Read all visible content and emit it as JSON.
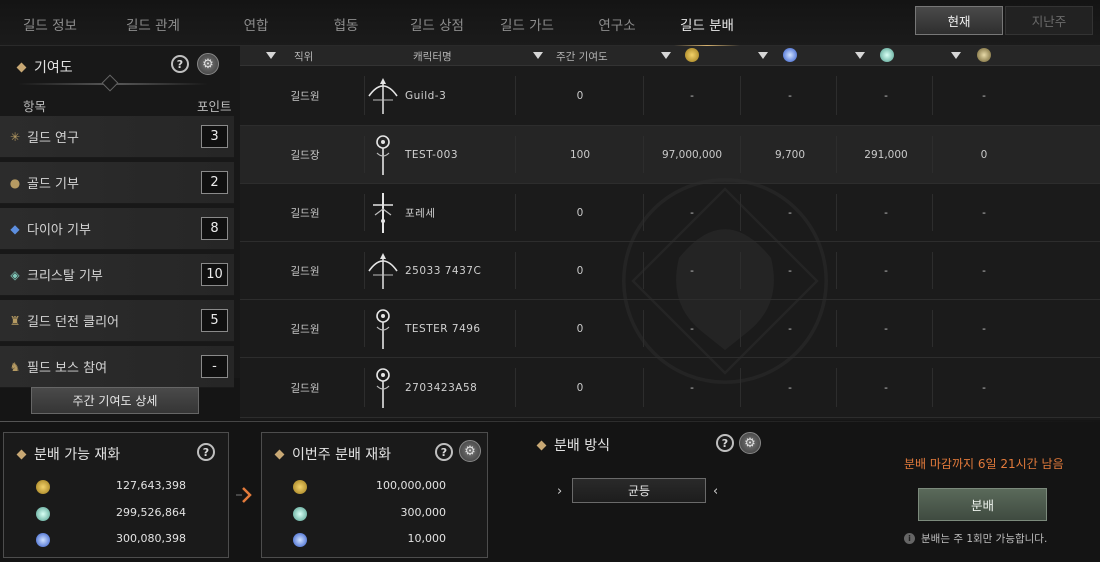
{
  "nav": {
    "tabs": [
      "길드 정보",
      "길드 관계",
      "연합",
      "협동",
      "길드 상점",
      "길드 가드",
      "연구소",
      "길드 분배"
    ],
    "active": "길드 분배",
    "current_label": "현재",
    "last_week_label": "지난주"
  },
  "contribution": {
    "title": "기여도",
    "col_item": "항목",
    "col_points": "포인트",
    "items": [
      {
        "label": "길드 연구",
        "points": "3",
        "icon": "research-icon"
      },
      {
        "label": "골드 기부",
        "points": "2",
        "icon": "gold-coin-icon"
      },
      {
        "label": "다이아 기부",
        "points": "8",
        "icon": "diamond-icon"
      },
      {
        "label": "크리스탈 기부",
        "points": "10",
        "icon": "crystal-icon"
      },
      {
        "label": "길드 던전 클리어",
        "points": "5",
        "icon": "dungeon-icon"
      },
      {
        "label": "필드 보스 참여",
        "points": "-",
        "icon": "boss-icon"
      }
    ],
    "weekly_detail_button": "주간 기여도 상세"
  },
  "table": {
    "headers": {
      "rank": "직위",
      "name": "캐릭터명",
      "weekly": "주간 기여도"
    },
    "currency_icons": [
      "gold-coin-icon",
      "diamond-icon",
      "crystal-icon",
      "guild-coin-icon"
    ],
    "rows": [
      {
        "rank": "길드원",
        "class": "bow",
        "name": "Guild-3",
        "weekly": "0",
        "gold": "-",
        "diamond": "-",
        "crystal": "-",
        "extra": "-"
      },
      {
        "rank": "길드장",
        "class": "staff",
        "name": "TEST-003",
        "weekly": "100",
        "gold": "97,000,000",
        "diamond": "9,700",
        "crystal": "291,000",
        "extra": "0"
      },
      {
        "rank": "길드원",
        "class": "sword",
        "name": "포레세",
        "weekly": "0",
        "gold": "-",
        "diamond": "-",
        "crystal": "-",
        "extra": "-"
      },
      {
        "rank": "길드원",
        "class": "bow",
        "name": "25033 7437C",
        "weekly": "0",
        "gold": "-",
        "diamond": "-",
        "crystal": "-",
        "extra": "-"
      },
      {
        "rank": "길드원",
        "class": "staff",
        "name": "TESTER 7496",
        "weekly": "0",
        "gold": "-",
        "diamond": "-",
        "crystal": "-",
        "extra": "-"
      },
      {
        "rank": "길드원",
        "class": "staff",
        "name": "2703423A58",
        "weekly": "0",
        "gold": "-",
        "diamond": "-",
        "crystal": "-",
        "extra": "-"
      }
    ]
  },
  "available": {
    "title": "분배 가능 재화",
    "items": [
      {
        "icon": "gold-coin-icon",
        "amount": "127,643,398"
      },
      {
        "icon": "crystal-icon",
        "amount": "299,526,864"
      },
      {
        "icon": "diamond-icon",
        "amount": "300,080,398"
      }
    ]
  },
  "this_week": {
    "title": "이번주 분배 재화",
    "items": [
      {
        "icon": "gold-coin-icon",
        "amount": "100,000,000"
      },
      {
        "icon": "crystal-icon",
        "amount": "300,000"
      },
      {
        "icon": "diamond-icon",
        "amount": "10,000"
      }
    ]
  },
  "method": {
    "title": "분배 방식",
    "value": "균등"
  },
  "deadline_text": "분배 마감까지 6일 21시간 남음",
  "distribute_button": "분배",
  "note": "분배는 주 1회만 가능합니다.",
  "colors": {
    "accent": "#c8a874",
    "deadline": "#e27a3b",
    "button": "#4a574b"
  }
}
